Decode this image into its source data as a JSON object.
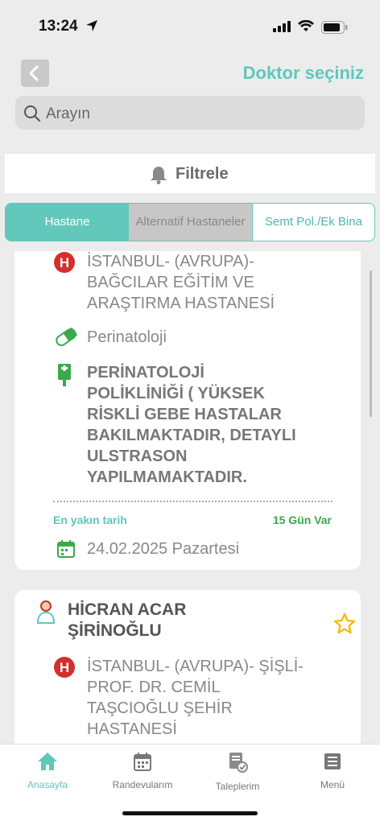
{
  "status": {
    "time": "13:24"
  },
  "header": {
    "title": "Doktor seçiniz"
  },
  "search": {
    "placeholder": "Arayın"
  },
  "filter": {
    "label": "Filtrele"
  },
  "tabs": [
    {
      "label": "Hastane"
    },
    {
      "label": "Alternatif Hastaneler"
    },
    {
      "label": "Semt Pol./Ek Bina"
    }
  ],
  "cards": [
    {
      "hospital": [
        "İSTANBUL- (AVRUPA)-",
        "BAĞCILAR EĞİTİM VE",
        "ARAŞTIRMA HASTANESİ"
      ],
      "department": "Perinatoloji",
      "clinic": [
        "PERİNATOLOJİ",
        "POLİKLİNİĞİ ( YÜKSEK",
        "RİSKLİ GEBE HASTALAR",
        "BAKILMAKTADIR, DETAYLI",
        "ULSTRASON",
        "YAPILMAMAKTADIR."
      ],
      "nearest_label": "En yakın tarih",
      "days_label": "15 Gün Var",
      "date": "24.02.2025 Pazartesi"
    },
    {
      "doctor": [
        "HİCRAN ACAR",
        "ŞİRİNOĞLU"
      ],
      "hospital": [
        "İSTANBUL- (AVRUPA)- ŞİŞLİ-",
        "PROF. DR. CEMİL",
        "TAŞCIOĞLU ŞEHİR",
        "HASTANESİ"
      ]
    }
  ],
  "nav": [
    {
      "label": "Anasayfa",
      "icon": "home-icon"
    },
    {
      "label": "Randevularım",
      "icon": "calendar-icon"
    },
    {
      "label": "Taleplerim",
      "icon": "requests-icon"
    },
    {
      "label": "Menü",
      "icon": "menu-icon"
    }
  ],
  "colors": {
    "accent": "#5ec8bb",
    "hospital_red": "#d32f2f",
    "green": "#3aaa4a",
    "star": "#f5b800"
  }
}
